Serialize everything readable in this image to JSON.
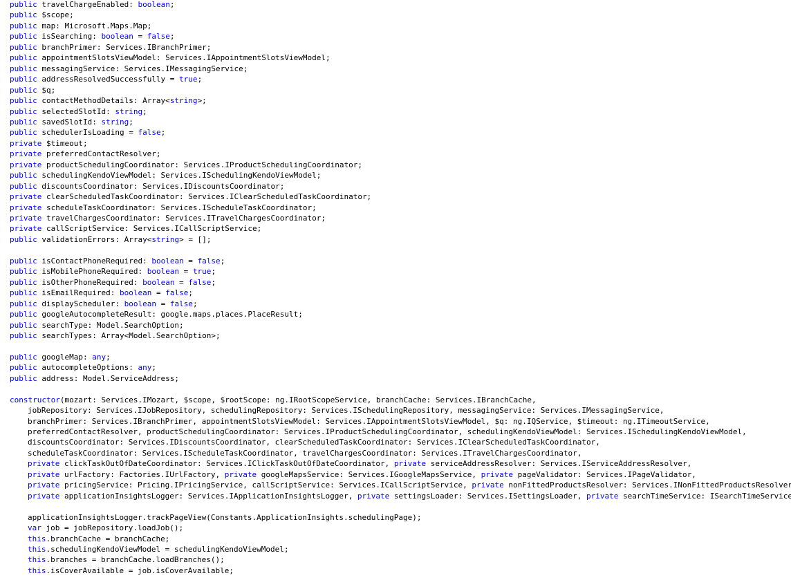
{
  "editor": {
    "name": "code-editor",
    "keyword_color": "#0000ff",
    "text_color": "#000000",
    "lines": [
      {
        "indent": 0,
        "tokens": [
          {
            "k": true,
            "v": "public"
          },
          {
            "v": " travelChargeEnabled: "
          },
          {
            "k": true,
            "v": "boolean"
          },
          {
            "v": ";"
          }
        ]
      },
      {
        "indent": 0,
        "tokens": [
          {
            "k": true,
            "v": "public"
          },
          {
            "v": " $scope;"
          }
        ]
      },
      {
        "indent": 0,
        "tokens": [
          {
            "k": true,
            "v": "public"
          },
          {
            "v": " map: Microsoft.Maps.Map;"
          }
        ]
      },
      {
        "indent": 0,
        "tokens": [
          {
            "k": true,
            "v": "public"
          },
          {
            "v": " isSearching: "
          },
          {
            "k": true,
            "v": "boolean"
          },
          {
            "v": " = "
          },
          {
            "k": true,
            "v": "false"
          },
          {
            "v": ";"
          }
        ]
      },
      {
        "indent": 0,
        "tokens": [
          {
            "k": true,
            "v": "public"
          },
          {
            "v": " branchPrimer: Services.IBranchPrimer;"
          }
        ]
      },
      {
        "indent": 0,
        "tokens": [
          {
            "k": true,
            "v": "public"
          },
          {
            "v": " appointmentSlotsViewModel: Services.IAppointmentSlotsViewModel;"
          }
        ]
      },
      {
        "indent": 0,
        "tokens": [
          {
            "k": true,
            "v": "public"
          },
          {
            "v": " messagingService: Services.IMessagingService;"
          }
        ]
      },
      {
        "indent": 0,
        "tokens": [
          {
            "k": true,
            "v": "public"
          },
          {
            "v": " addressResolvedSuccessfully = "
          },
          {
            "k": true,
            "v": "true"
          },
          {
            "v": ";"
          }
        ]
      },
      {
        "indent": 0,
        "tokens": [
          {
            "k": true,
            "v": "public"
          },
          {
            "v": " $q;"
          }
        ]
      },
      {
        "indent": 0,
        "tokens": [
          {
            "k": true,
            "v": "public"
          },
          {
            "v": " contactMethodDetails: Array<"
          },
          {
            "k": true,
            "v": "string"
          },
          {
            "v": ">;"
          }
        ]
      },
      {
        "indent": 0,
        "tokens": [
          {
            "k": true,
            "v": "public"
          },
          {
            "v": " selectedSlotId: "
          },
          {
            "k": true,
            "v": "string"
          },
          {
            "v": ";"
          }
        ]
      },
      {
        "indent": 0,
        "tokens": [
          {
            "k": true,
            "v": "public"
          },
          {
            "v": " savedSlotId: "
          },
          {
            "k": true,
            "v": "string"
          },
          {
            "v": ";"
          }
        ]
      },
      {
        "indent": 0,
        "tokens": [
          {
            "k": true,
            "v": "public"
          },
          {
            "v": " schedulerIsLoading = "
          },
          {
            "k": true,
            "v": "false"
          },
          {
            "v": ";"
          }
        ]
      },
      {
        "indent": 0,
        "tokens": [
          {
            "k": true,
            "v": "private"
          },
          {
            "v": " $timeout;"
          }
        ]
      },
      {
        "indent": 0,
        "tokens": [
          {
            "k": true,
            "v": "private"
          },
          {
            "v": " preferredContactResolver;"
          }
        ]
      },
      {
        "indent": 0,
        "tokens": [
          {
            "k": true,
            "v": "private"
          },
          {
            "v": " productSchedulingCoordinator: Services.IProductSchedulingCoordinator;"
          }
        ]
      },
      {
        "indent": 0,
        "tokens": [
          {
            "k": true,
            "v": "public"
          },
          {
            "v": " schedulingKendoViewModel: Services.ISchedulingKendoViewModel;"
          }
        ]
      },
      {
        "indent": 0,
        "tokens": [
          {
            "k": true,
            "v": "public"
          },
          {
            "v": " discountsCoordinator: Services.IDiscountsCoordinator;"
          }
        ]
      },
      {
        "indent": 0,
        "tokens": [
          {
            "k": true,
            "v": "private"
          },
          {
            "v": " clearScheduledTaskCoordinator: Services.IClearScheduledTaskCoordinator;"
          }
        ]
      },
      {
        "indent": 0,
        "tokens": [
          {
            "k": true,
            "v": "private"
          },
          {
            "v": " scheduleTaskCoordinator: Services.IScheduleTaskCoordinator;"
          }
        ]
      },
      {
        "indent": 0,
        "tokens": [
          {
            "k": true,
            "v": "private"
          },
          {
            "v": " travelChargesCoordinator: Services.ITravelChargesCoordinator;"
          }
        ]
      },
      {
        "indent": 0,
        "tokens": [
          {
            "k": true,
            "v": "private"
          },
          {
            "v": " callScriptService: Services.ICallScriptService;"
          }
        ]
      },
      {
        "indent": 0,
        "tokens": [
          {
            "k": true,
            "v": "public"
          },
          {
            "v": " validationErrors: Array<"
          },
          {
            "k": true,
            "v": "string"
          },
          {
            "v": "> = [];"
          }
        ]
      },
      {
        "indent": 0,
        "tokens": []
      },
      {
        "indent": 0,
        "tokens": [
          {
            "k": true,
            "v": "public"
          },
          {
            "v": " isContactPhoneRequired: "
          },
          {
            "k": true,
            "v": "boolean"
          },
          {
            "v": " = "
          },
          {
            "k": true,
            "v": "false"
          },
          {
            "v": ";"
          }
        ]
      },
      {
        "indent": 0,
        "tokens": [
          {
            "k": true,
            "v": "public"
          },
          {
            "v": " isMobilePhoneRequired: "
          },
          {
            "k": true,
            "v": "boolean"
          },
          {
            "v": " = "
          },
          {
            "k": true,
            "v": "true"
          },
          {
            "v": ";"
          }
        ]
      },
      {
        "indent": 0,
        "tokens": [
          {
            "k": true,
            "v": "public"
          },
          {
            "v": " isOtherPhoneRequired: "
          },
          {
            "k": true,
            "v": "boolean"
          },
          {
            "v": " = "
          },
          {
            "k": true,
            "v": "false"
          },
          {
            "v": ";"
          }
        ]
      },
      {
        "indent": 0,
        "tokens": [
          {
            "k": true,
            "v": "public"
          },
          {
            "v": " isEmailRequired: "
          },
          {
            "k": true,
            "v": "boolean"
          },
          {
            "v": " = "
          },
          {
            "k": true,
            "v": "false"
          },
          {
            "v": ";"
          }
        ]
      },
      {
        "indent": 0,
        "tokens": [
          {
            "k": true,
            "v": "public"
          },
          {
            "v": " displayScheduler: "
          },
          {
            "k": true,
            "v": "boolean"
          },
          {
            "v": " = "
          },
          {
            "k": true,
            "v": "false"
          },
          {
            "v": ";"
          }
        ]
      },
      {
        "indent": 0,
        "tokens": [
          {
            "k": true,
            "v": "public"
          },
          {
            "v": " googleAutocompleteResult: google.maps.places.PlaceResult;"
          }
        ]
      },
      {
        "indent": 0,
        "tokens": [
          {
            "k": true,
            "v": "public"
          },
          {
            "v": " searchType: Model.SearchOption;"
          }
        ]
      },
      {
        "indent": 0,
        "tokens": [
          {
            "k": true,
            "v": "public"
          },
          {
            "v": " searchTypes: Array<Model.SearchOption>;"
          }
        ]
      },
      {
        "indent": 0,
        "tokens": []
      },
      {
        "indent": 0,
        "tokens": [
          {
            "k": true,
            "v": "public"
          },
          {
            "v": " googleMap: "
          },
          {
            "k": true,
            "v": "any"
          },
          {
            "v": ";"
          }
        ]
      },
      {
        "indent": 0,
        "tokens": [
          {
            "k": true,
            "v": "public"
          },
          {
            "v": " autocompleteOptions: "
          },
          {
            "k": true,
            "v": "any"
          },
          {
            "v": ";"
          }
        ]
      },
      {
        "indent": 0,
        "tokens": [
          {
            "k": true,
            "v": "public"
          },
          {
            "v": " address: Model.ServiceAddress;"
          }
        ]
      },
      {
        "indent": 0,
        "tokens": []
      },
      {
        "indent": 0,
        "tokens": [
          {
            "k": true,
            "v": "constructor"
          },
          {
            "v": "(mozart: Services.IMozart, $scope, $rootScope: ng.IRootScopeService, branchCache: Services.IBranchCache,"
          }
        ]
      },
      {
        "indent": 1,
        "tokens": [
          {
            "v": "jobRepository: Services.IJobRepository, schedulingRepository: Services.ISchedulingRepository, messagingService: Services.IMessagingService,"
          }
        ]
      },
      {
        "indent": 1,
        "tokens": [
          {
            "v": "branchPrimer: Services.IBranchPrimer, appointmentSlotsViewModel: Services.IAppointmentSlotsViewModel, $q: ng.IQService, $timeout: ng.ITimeoutService,"
          }
        ]
      },
      {
        "indent": 1,
        "tokens": [
          {
            "v": "preferredContactResolver, productSchedulingCoordinator: Services.IProductSchedulingCoordinator, schedulingKendoViewModel: Services.ISchedulingKendoViewModel,"
          }
        ]
      },
      {
        "indent": 1,
        "tokens": [
          {
            "v": "discountsCoordinator: Services.IDiscountsCoordinator, clearScheduledTaskCoordinator: Services.IClearScheduledTaskCoordinator,"
          }
        ]
      },
      {
        "indent": 1,
        "tokens": [
          {
            "v": "scheduleTaskCoordinator: Services.IScheduleTaskCoordinator, travelChargesCoordinator: Services.ITravelChargesCoordinator,"
          }
        ]
      },
      {
        "indent": 1,
        "tokens": [
          {
            "k": true,
            "v": "private"
          },
          {
            "v": " clickTaskOutOfDateCoordinator: Services.IClickTaskOutOfDateCoordinator, "
          },
          {
            "k": true,
            "v": "private"
          },
          {
            "v": " serviceAddressResolver: Services.IServiceAddressResolver,"
          }
        ]
      },
      {
        "indent": 1,
        "tokens": [
          {
            "k": true,
            "v": "private"
          },
          {
            "v": " urlFactory: Factories.IUrlFactory, "
          },
          {
            "k": true,
            "v": "private"
          },
          {
            "v": " googleMapsService: Services.IGoogleMapsService, "
          },
          {
            "k": true,
            "v": "private"
          },
          {
            "v": " pageValidator: Services.IPageValidator,"
          }
        ]
      },
      {
        "indent": 1,
        "tokens": [
          {
            "k": true,
            "v": "private"
          },
          {
            "v": " pricingService: Pricing.IPricingService, callScriptService: Services.ICallScriptService, "
          },
          {
            "k": true,
            "v": "private"
          },
          {
            "v": " nonFittedProductsResolver: Services.INonFittedProductsResolver,"
          }
        ]
      },
      {
        "indent": 1,
        "tokens": [
          {
            "k": true,
            "v": "private"
          },
          {
            "v": " applicationInsightsLogger: Services.IApplicationInsightsLogger, "
          },
          {
            "k": true,
            "v": "private"
          },
          {
            "v": " settingsLoader: Services.ISettingsLoader, "
          },
          {
            "k": true,
            "v": "private"
          },
          {
            "v": " searchTimeService: ISearchTimeService) {"
          }
        ]
      },
      {
        "indent": 0,
        "tokens": []
      },
      {
        "indent": 1,
        "tokens": [
          {
            "v": "applicationInsightsLogger.trackPageView(Constants.ApplicationInsights.schedulingPage);"
          }
        ]
      },
      {
        "indent": 1,
        "tokens": [
          {
            "k": true,
            "v": "var"
          },
          {
            "v": " job = jobRepository.loadJob();"
          }
        ]
      },
      {
        "indent": 1,
        "tokens": [
          {
            "k": true,
            "v": "this"
          },
          {
            "v": ".branchCache = branchCache;"
          }
        ]
      },
      {
        "indent": 1,
        "tokens": [
          {
            "k": true,
            "v": "this"
          },
          {
            "v": ".schedulingKendoViewModel = schedulingKendoViewModel;"
          }
        ]
      },
      {
        "indent": 1,
        "tokens": [
          {
            "k": true,
            "v": "this"
          },
          {
            "v": ".branches = branchCache.loadBranches();"
          }
        ]
      },
      {
        "indent": 1,
        "tokens": [
          {
            "k": true,
            "v": "this"
          },
          {
            "v": ".isCoverAvailable = job.isCoverAvailable;"
          }
        ]
      }
    ]
  }
}
